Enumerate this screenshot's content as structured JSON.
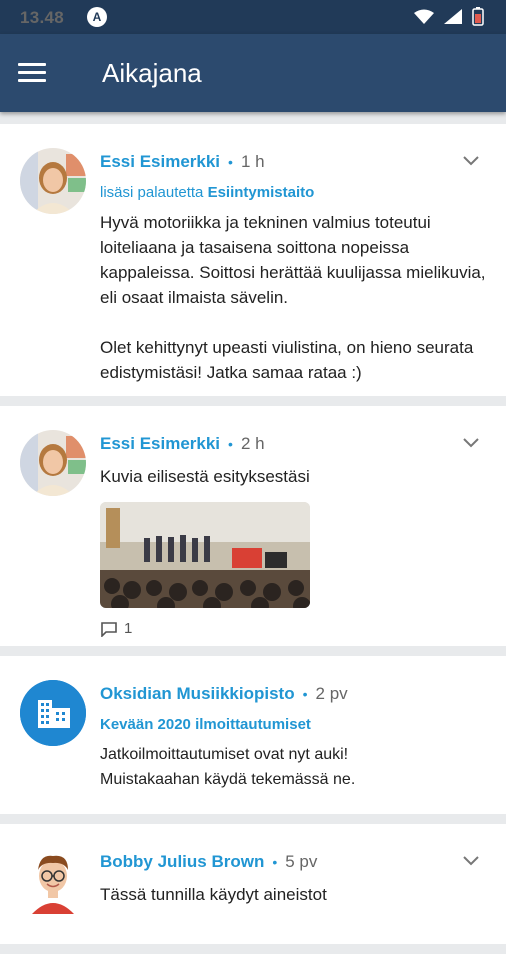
{
  "status_bar": {
    "time": "13.48",
    "badge": "A"
  },
  "app_bar": {
    "title": "Aikajana"
  },
  "posts": [
    {
      "author": "Essi Esimerkki",
      "time": "1 h",
      "action": "lisäsi palautetta",
      "topic": "Esiintymistaito",
      "paragraphs": [
        "Hyvä motoriikka ja tekninen valmius toteutui loiteliaana ja tasaisena soittona nopeissa kappaleissa. Soittosi herättää kuulijassa mielikuvia, eli osaat ilmaista sävelin.",
        "Olet kehittynyt upeasti viulistina, on hieno seurata edistymistäsi! Jatka samaa rataa :)"
      ]
    },
    {
      "author": "Essi Esimerkki",
      "time": "2 h",
      "text": "Kuvia eilisestä esityksestäsi",
      "comment_count": "1"
    },
    {
      "author": "Oksidian Musiikkiopisto",
      "time": "2 pv",
      "subtitle": "Kevään 2020 ilmoittautumiset",
      "text": "Jatkoilmoittautumiset ovat nyt auki! Muistakaahan käydä tekemässä ne."
    },
    {
      "author": "Bobby Julius Brown",
      "time": "5 pv",
      "text": "Tässä tunnilla käydyt aineistot"
    }
  ],
  "colors": {
    "status_bar": "#213a58",
    "app_bar": "#2c4a6e",
    "accent": "#2196d3",
    "background": "#e8eaec"
  },
  "icons": [
    "menu-icon",
    "chevron-down-icon",
    "comment-icon",
    "building-icon",
    "wifi-icon",
    "signal-icon",
    "battery-icon"
  ]
}
